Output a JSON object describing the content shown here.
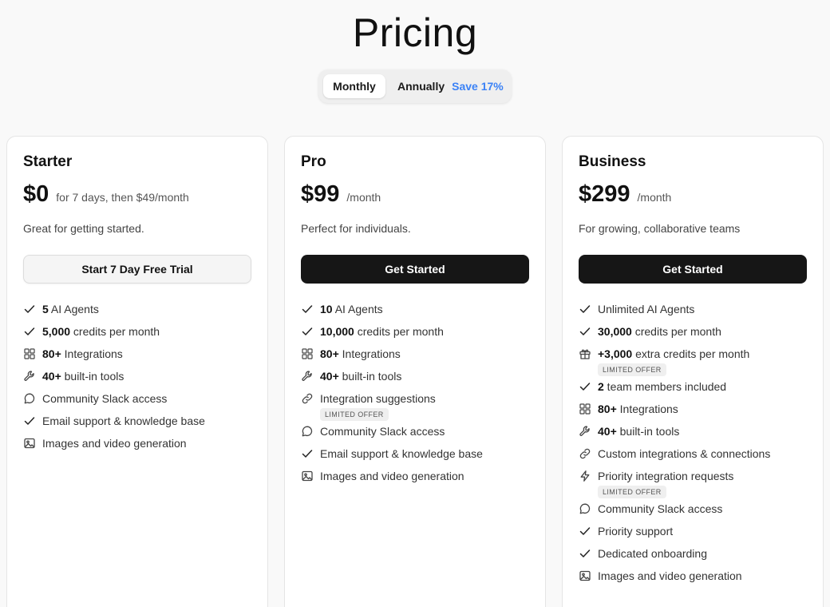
{
  "page_title": "Pricing",
  "billing": {
    "monthly_label": "Monthly",
    "annually_label": "Annually",
    "save_label": "Save 17%",
    "selected": "Monthly"
  },
  "colors": {
    "accent_blue": "#3b82f6",
    "button_dark": "#161616"
  },
  "plans": [
    {
      "name": "Starter",
      "price": "$0",
      "period": "for 7 days, then $49/month",
      "description": "Great for getting started.",
      "cta": "Start 7 Day Free Trial",
      "features": [
        {
          "icon": "check-icon",
          "bold": "5",
          "text": " AI Agents"
        },
        {
          "icon": "check-icon",
          "bold": "5,000",
          "text": " credits per month"
        },
        {
          "icon": "grid-icon",
          "bold": "80+",
          "text": " Integrations"
        },
        {
          "icon": "wrench-icon",
          "bold": "40+",
          "text": " built-in tools"
        },
        {
          "icon": "chat-icon",
          "bold": "",
          "text": "Community Slack access"
        },
        {
          "icon": "check-icon",
          "bold": "",
          "text": "Email support & knowledge base"
        },
        {
          "icon": "image-icon",
          "bold": "",
          "text": "Images and video generation"
        }
      ]
    },
    {
      "name": "Pro",
      "price": "$99",
      "period": "/month",
      "description": "Perfect for individuals.",
      "cta": "Get Started",
      "features": [
        {
          "icon": "check-icon",
          "bold": "10",
          "text": " AI Agents"
        },
        {
          "icon": "check-icon",
          "bold": "10,000",
          "text": " credits per month"
        },
        {
          "icon": "grid-icon",
          "bold": "80+",
          "text": " Integrations"
        },
        {
          "icon": "wrench-icon",
          "bold": "40+",
          "text": " built-in tools"
        },
        {
          "icon": "link-icon",
          "bold": "",
          "text": "Integration suggestions",
          "badge": "LIMITED OFFER"
        },
        {
          "icon": "chat-icon",
          "bold": "",
          "text": "Community Slack access"
        },
        {
          "icon": "check-icon",
          "bold": "",
          "text": "Email support & knowledge base"
        },
        {
          "icon": "image-icon",
          "bold": "",
          "text": "Images and video generation"
        }
      ]
    },
    {
      "name": "Business",
      "price": "$299",
      "period": "/month",
      "description": "For growing, collaborative teams",
      "cta": "Get Started",
      "features": [
        {
          "icon": "check-icon",
          "bold": "",
          "text": "Unlimited AI Agents"
        },
        {
          "icon": "check-icon",
          "bold": "30,000",
          "text": " credits per month"
        },
        {
          "icon": "gift-icon",
          "bold": "+3,000",
          "text": " extra credits per month",
          "badge": "LIMITED OFFER"
        },
        {
          "icon": "check-icon",
          "bold": "2",
          "text": " team members included"
        },
        {
          "icon": "grid-icon",
          "bold": "80+",
          "text": " Integrations"
        },
        {
          "icon": "wrench-icon",
          "bold": "40+",
          "text": " built-in tools"
        },
        {
          "icon": "link-icon",
          "bold": "",
          "text": "Custom integrations & connections"
        },
        {
          "icon": "bolt-icon",
          "bold": "",
          "text": "Priority integration requests",
          "badge": "LIMITED OFFER"
        },
        {
          "icon": "chat-icon",
          "bold": "",
          "text": "Community Slack access"
        },
        {
          "icon": "check-icon",
          "bold": "",
          "text": "Priority support"
        },
        {
          "icon": "check-icon",
          "bold": "",
          "text": "Dedicated onboarding"
        },
        {
          "icon": "image-icon",
          "bold": "",
          "text": "Images and video generation"
        }
      ]
    }
  ]
}
